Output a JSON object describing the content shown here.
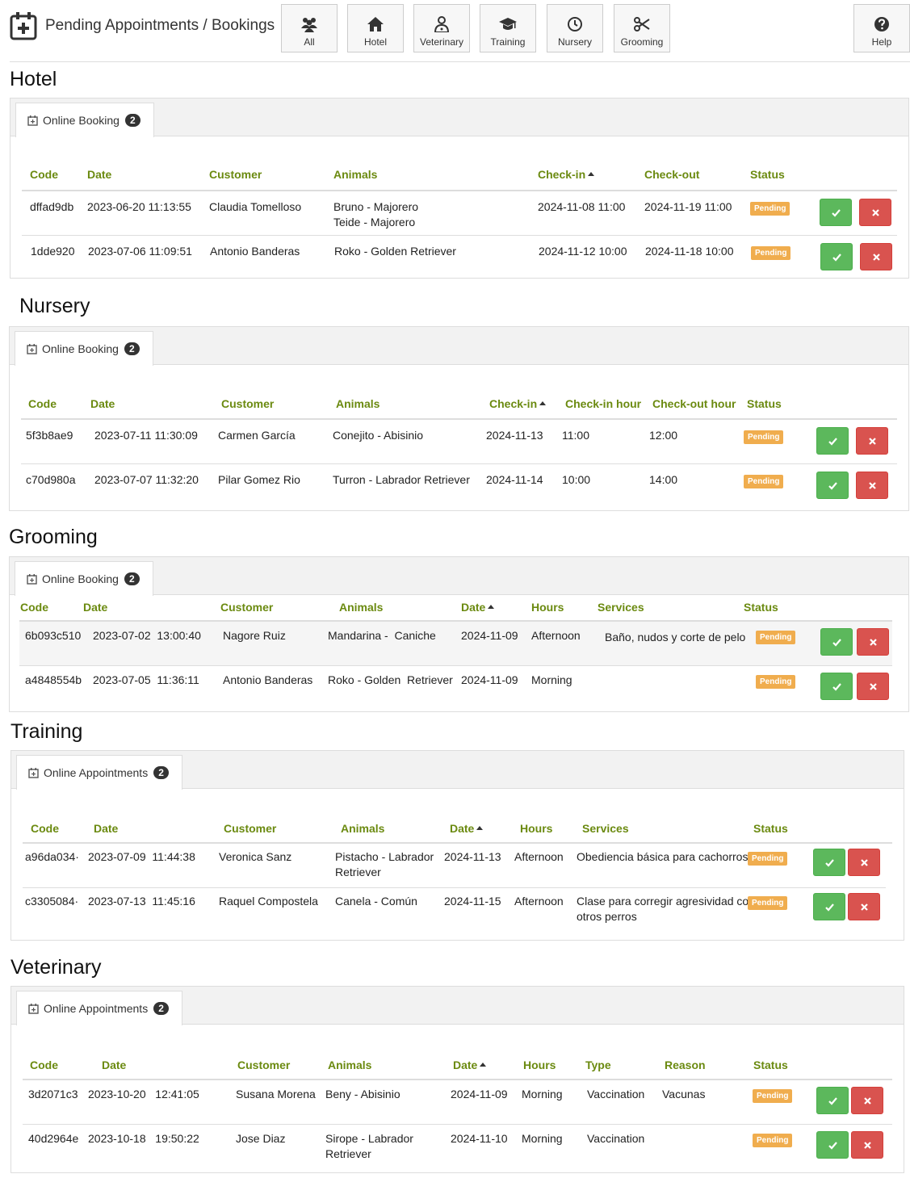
{
  "header": {
    "title": "Pending Appointments / Bookings",
    "nav": [
      {
        "label": "All",
        "icon": "users-icon"
      },
      {
        "label": "Hotel",
        "icon": "home-icon"
      },
      {
        "label": "Veterinary",
        "icon": "doctor-icon"
      },
      {
        "label": "Training",
        "icon": "graduation-cap-icon"
      },
      {
        "label": "Nursery",
        "icon": "clock-icon"
      },
      {
        "label": "Grooming",
        "icon": "scissors-icon"
      }
    ],
    "help_label": "Help"
  },
  "colors": {
    "accent": "#6b8a10",
    "pending": "#f0ad4e",
    "approve": "#5cb85c",
    "reject": "#d9534f"
  },
  "hotel": {
    "title": "Hotel",
    "tab_label": "Online Booking",
    "tab_count": "2",
    "headers": [
      "Code",
      "Date",
      "Customer",
      "Animals",
      "Check-in",
      "Check-out",
      "Status"
    ],
    "rows": [
      {
        "code": "dffad9db",
        "date": "2023-06-20 11:13:55",
        "customer": "Claudia Tomelloso",
        "animals": "Bruno - Majorero",
        "animals2": "Teide - Majorero",
        "checkin": "2024-11-08 11:00",
        "checkout": "2024-11-19 11:00",
        "status": "Pending"
      },
      {
        "code": "1dde920",
        "date": "2023-07-06 11:09:51",
        "customer": "Antonio Banderas",
        "animals": "Roko - Golden Retriever",
        "animals2": "",
        "checkin": "2024-11-12 10:00",
        "checkout": "2024-11-18 10:00",
        "status": "Pending"
      }
    ]
  },
  "nursery": {
    "title": "Nursery",
    "tab_label": "Online Booking",
    "tab_count": "2",
    "headers": [
      "Code",
      "Date",
      "Customer",
      "Animals",
      "Check-in",
      "Check-in hour",
      "Check-out hour",
      "Status"
    ],
    "rows": [
      {
        "code": "5f3b8ae9",
        "date": "2023-07-11 11:30:09",
        "customer": "Carmen García",
        "animals": "Conejito - Abisinio",
        "checkin": "2024-11-13",
        "checkin_hour": "11:00",
        "checkout_hour": "12:00",
        "status": "Pending"
      },
      {
        "code": "c70d980a",
        "date": "2023-07-07 11:32:20",
        "customer": "Pilar Gomez Rio",
        "animals": "Turron - Labrador Retriever",
        "checkin": "2024-11-14",
        "checkin_hour": "10:00",
        "checkout_hour": "14:00",
        "status": "Pending"
      }
    ]
  },
  "grooming": {
    "title": "Grooming",
    "tab_label": "Online Booking",
    "tab_count": "2",
    "headers": [
      "Code",
      "Date",
      "Customer",
      "Animals",
      "Date",
      "Hours",
      "Services",
      "Status"
    ],
    "rows": [
      {
        "code": "6b093c510",
        "date": "2023-07-02  13:00:40",
        "customer": "Nagore Ruiz",
        "animals": "Mandarina -  Caniche",
        "appt_date": "2024-11-09",
        "hours": "Afternoon",
        "services": "Baño, nudos y corte de pelo",
        "status": "Pending"
      },
      {
        "code": "a4848554b",
        "date": "2023-07-05  11:36:11",
        "customer": "Antonio Banderas",
        "animals": "Roko - Golden  Retriever",
        "appt_date": "2024-11-09",
        "hours": "Morning",
        "services": "",
        "status": "Pending"
      }
    ]
  },
  "training": {
    "title": "Training",
    "tab_label": "Online Appointments",
    "tab_count": "2",
    "headers": [
      "Code",
      "Date",
      "Customer",
      "Animals",
      "Date",
      "Hours",
      "Services",
      "Status"
    ],
    "rows": [
      {
        "code": "a96da034·",
        "date": "2023-07-09  11:44:38",
        "customer": "Veronica Sanz",
        "animals": "Pistacho - Labrador",
        "animals2": "Retriever",
        "appt_date": "2024-11-13",
        "hours": "Afternoon",
        "services": "Obediencia básica para cachorros",
        "services2": "",
        "status": "Pending"
      },
      {
        "code": "c3305084·",
        "date": "2023-07-13  11:45:16",
        "customer": "Raquel Compostela",
        "animals": "Canela - Común",
        "animals2": "",
        "appt_date": "2024-11-15",
        "hours": "Afternoon",
        "services": "Clase para corregir agresividad con",
        "services2": "otros perros",
        "status": "Pending"
      }
    ]
  },
  "veterinary": {
    "title": "Veterinary",
    "tab_label": "Online Appointments",
    "tab_count": "2",
    "headers": [
      "Code",
      "Date",
      "Customer",
      "Animals",
      "Date",
      "Hours",
      "Type",
      "Reason",
      "Status"
    ],
    "rows": [
      {
        "code": "3d2071c3",
        "date": "2023-10-20   12:41:05",
        "customer": "Susana Morena",
        "animals": "Beny - Abisinio",
        "animals2": "",
        "appt_date": "2024-11-09",
        "hours": "Morning",
        "type": "Vaccination",
        "reason": "Vacunas",
        "status": "Pending"
      },
      {
        "code": "40d2964e",
        "date": "2023-10-18   19:50:22",
        "customer": "Jose Diaz",
        "animals": "Sirope - Labrador",
        "animals2": "Retriever",
        "appt_date": "2024-11-10",
        "hours": "Morning",
        "type": "Vaccination",
        "reason": "",
        "status": "Pending"
      }
    ]
  }
}
